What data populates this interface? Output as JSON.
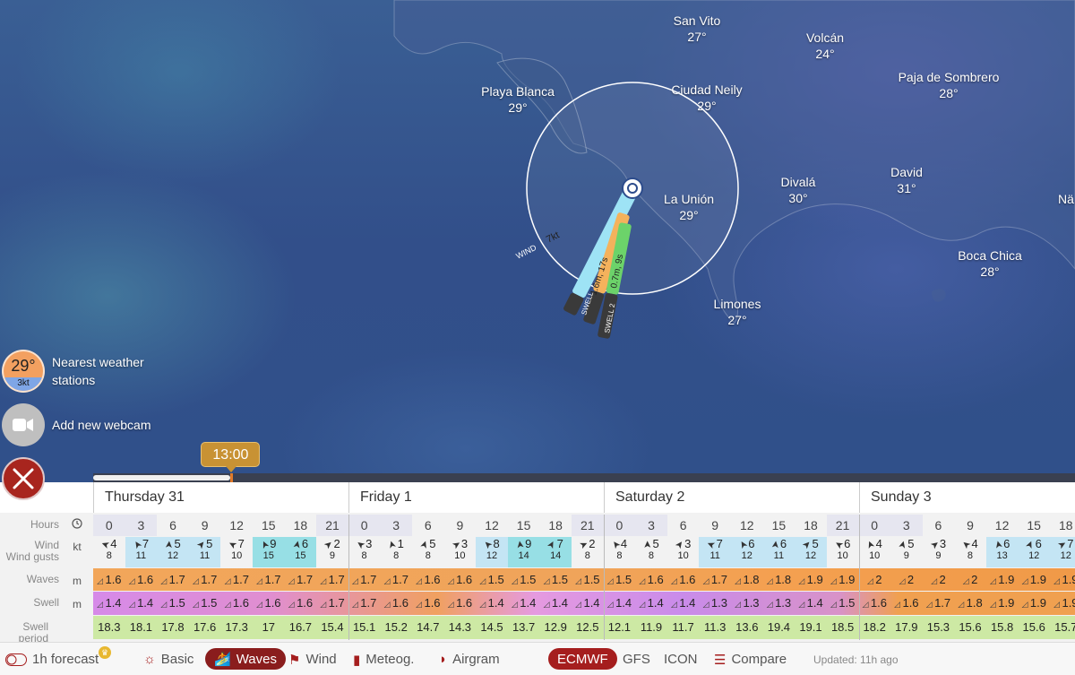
{
  "map": {
    "places": [
      {
        "name": "San Vito",
        "temp": "27°"
      },
      {
        "name": "Volcán",
        "temp": "24°"
      },
      {
        "name": "Paja de Sombrero",
        "temp": "28°"
      },
      {
        "name": "Playa Blanca",
        "temp": "29°"
      },
      {
        "name": "Ciudad Neily",
        "temp": "29°"
      },
      {
        "name": "Divalá",
        "temp": "30°"
      },
      {
        "name": "David",
        "temp": "31°"
      },
      {
        "name": "La Unión",
        "temp": "29°"
      },
      {
        "name": "Boca Chica",
        "temp": "28°"
      },
      {
        "name": "Limones",
        "temp": "27°"
      },
      {
        "name": "Nä",
        "temp": ""
      }
    ],
    "picker": {
      "wind_label": "WIND",
      "wind_value": "7kt",
      "swell_label": "SWELL",
      "swell_value": "1.6m, 17s",
      "swell2_label": "SWELL 2",
      "swell2_value": "0.7m, 9s"
    }
  },
  "side": {
    "station_temp": "29°",
    "station_wind": "3kt",
    "station_label_1": "Nearest weather",
    "station_label_2": "stations",
    "webcam_label": "Add new webcam"
  },
  "timeline": {
    "time": "13:00",
    "progress": 0.14
  },
  "forecast": {
    "days": [
      "Thursday 31",
      "Friday 1",
      "Saturday 2",
      "Sunday 3"
    ],
    "labels": {
      "hours": "Hours",
      "wind": "Wind",
      "gusts": "Wind gusts",
      "waves": "Waves",
      "swell": "Swell",
      "period": "Swell period",
      "kt": "kt",
      "m": "m"
    },
    "hours": [
      "0",
      "3",
      "6",
      "9",
      "12",
      "15",
      "18",
      "21",
      "0",
      "3",
      "6",
      "9",
      "12",
      "15",
      "18",
      "21",
      "0",
      "3",
      "6",
      "9",
      "12",
      "15",
      "18",
      "21",
      "0",
      "3",
      "6",
      "9",
      "12",
      "15",
      "18"
    ],
    "wind": [
      "4",
      "7",
      "5",
      "5",
      "7",
      "9",
      "6",
      "2",
      "3",
      "1",
      "5",
      "3",
      "8",
      "9",
      "7",
      "2",
      "4",
      "5",
      "3",
      "7",
      "6",
      "6",
      "5",
      "6",
      "4",
      "5",
      "3",
      "4",
      "6",
      "6",
      "7"
    ],
    "gusts": [
      "8",
      "11",
      "12",
      "11",
      "10",
      "15",
      "15",
      "9",
      "8",
      "8",
      "8",
      "10",
      "12",
      "14",
      "14",
      "8",
      "8",
      "8",
      "10",
      "11",
      "12",
      "11",
      "12",
      "10",
      "10",
      "9",
      "9",
      "8",
      "13",
      "12",
      "12"
    ],
    "waves": [
      "1.6",
      "1.6",
      "1.7",
      "1.7",
      "1.7",
      "1.7",
      "1.7",
      "1.7",
      "1.7",
      "1.7",
      "1.6",
      "1.6",
      "1.5",
      "1.5",
      "1.5",
      "1.5",
      "1.5",
      "1.6",
      "1.6",
      "1.7",
      "1.8",
      "1.8",
      "1.9",
      "1.9",
      "2",
      "2",
      "2",
      "2",
      "1.9",
      "1.9",
      "1.9"
    ],
    "swell": [
      "1.4",
      "1.4",
      "1.5",
      "1.5",
      "1.6",
      "1.6",
      "1.6",
      "1.7",
      "1.7",
      "1.6",
      "1.6",
      "1.6",
      "1.4",
      "1.4",
      "1.4",
      "1.4",
      "1.4",
      "1.4",
      "1.4",
      "1.3",
      "1.3",
      "1.3",
      "1.4",
      "1.5",
      "1.6",
      "1.6",
      "1.7",
      "1.8",
      "1.9",
      "1.9",
      "1.9"
    ],
    "period": [
      "18.3",
      "18.1",
      "17.8",
      "17.6",
      "17.3",
      "17",
      "16.7",
      "15.4",
      "15.1",
      "15.2",
      "14.7",
      "14.3",
      "14.5",
      "13.7",
      "12.9",
      "12.5",
      "12.1",
      "11.9",
      "11.7",
      "11.3",
      "13.6",
      "19.4",
      "19.1",
      "18.5",
      "18.2",
      "17.9",
      "15.3",
      "15.6",
      "15.8",
      "15.6",
      "15.7"
    ]
  },
  "bottombar": {
    "forecast_1h": "1h forecast",
    "tabs": [
      "Basic",
      "Waves",
      "Wind",
      "Meteog.",
      "Airgram"
    ],
    "active_tab": "Waves",
    "models": [
      "ECMWF",
      "GFS",
      "ICON"
    ],
    "active_model": "ECMWF",
    "compare": "Compare",
    "updated": "Updated: 11h ago"
  },
  "colors": {
    "accent": "#a51e1e",
    "timeline_bubble": "#c89234",
    "waves_bg": "#f0a050",
    "swell_bg": "#d58ae0",
    "period_bg": "#c9e89a"
  }
}
